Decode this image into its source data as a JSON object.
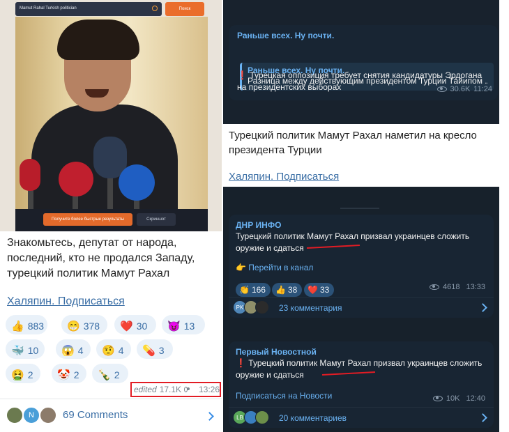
{
  "left_post": {
    "photo": {
      "search_query": "Mamut Rahal Turkish politician",
      "search_button": "Поиск",
      "results_button": "Получите более быстрые результаты",
      "screenshot_button": "Скриншот"
    },
    "text": "Знакомьтесь, депутат от народа, последний, кто не продался Западу, турецкий политик Мамут Рахал",
    "subscribe_link": "Халяпин. Подписаться",
    "reactions": [
      {
        "emoji": "👍",
        "count": "883"
      },
      {
        "emoji": "😁",
        "count": "378"
      },
      {
        "emoji": "❤️",
        "count": "30"
      },
      {
        "emoji": "😈",
        "count": "13"
      },
      {
        "emoji": "🐳",
        "count": "10"
      },
      {
        "emoji": "😱",
        "count": "4"
      },
      {
        "emoji": "🤨",
        "count": "4"
      },
      {
        "emoji": "💊",
        "count": "3"
      },
      {
        "emoji": "🤮",
        "count": "2"
      },
      {
        "emoji": "🤡",
        "count": "2"
      },
      {
        "emoji": "🍾",
        "count": "2"
      }
    ],
    "meta": {
      "edited": "edited",
      "views": "17.1K",
      "time": "13:26"
    },
    "comments": {
      "avatar_letter": "N",
      "label": "69 Comments"
    }
  },
  "top_right_post": {
    "channel": "Раньше всех. Ну почти.",
    "quote_channel": "Раньше всех. Ну почти.",
    "quote_text": "Разница между действующим президентом Турции Тайипом ...",
    "text_icon": "❗",
    "text": "Турецкая оппозиция требует снятия кандидатуры Эрдогана на президентских выборах",
    "views": "30.6K",
    "time": "11:24"
  },
  "mid_right_post": {
    "text": "Турецкий политик Мамут Рахал наметил на кресло президента Турции",
    "subscribe_link": "Халяпин. Подписаться"
  },
  "card1": {
    "channel": "ДНР ИНФО",
    "text": "Турецкий политик Мамут Рахал призвал украинцев сложить оружие и сдаться",
    "link_icon": "👉",
    "link": "Перейти в канал",
    "reactions": [
      {
        "emoji": "👏",
        "count": "166"
      },
      {
        "emoji": "👍",
        "count": "38"
      },
      {
        "emoji": "❤️",
        "count": "33"
      }
    ],
    "views": "4618",
    "time": "13:33",
    "avatar_initials": "PK",
    "comments": "23 комментария"
  },
  "card2": {
    "channel": "Первый Новостной",
    "text_icon": "❗",
    "text": "Турецкий политик Мамут Рахал призвал украинцев сложить оружие и сдаться",
    "link": "Подписаться на Новости",
    "views": "10K",
    "time": "12:40",
    "avatar_initials": "LB",
    "comments": "20 комментариев"
  },
  "colors": {
    "highlight_red": "#e21c24",
    "telegram_dark_bg": "#17212b",
    "telegram_link": "#6ab2f2",
    "light_link": "#3a6ea5"
  }
}
